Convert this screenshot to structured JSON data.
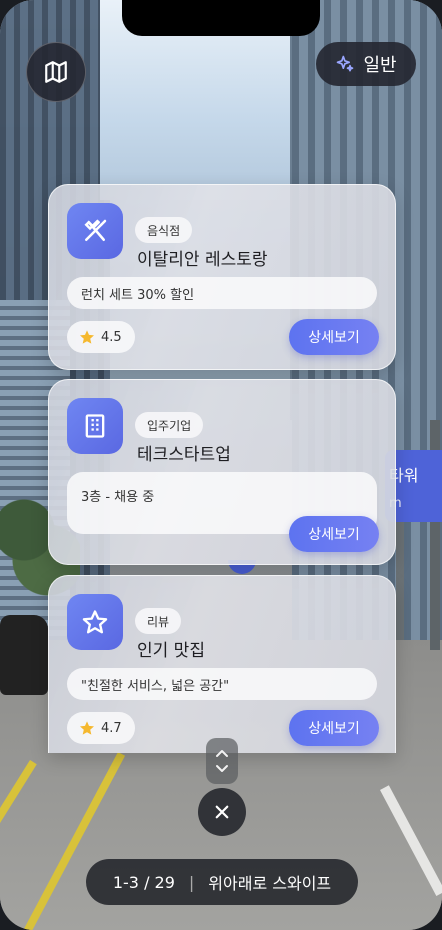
{
  "top": {
    "map_icon": "map-icon",
    "mode_label": "일반",
    "mode_icon": "sparkle-icon"
  },
  "landmark": {
    "title": "타워",
    "distance": "m"
  },
  "cards": [
    {
      "icon": "restaurant-icon",
      "category": "음식점",
      "name": "이탈리안 레스토랑",
      "description": "런치 세트 30% 할인",
      "rating": "4.5",
      "detail_label": "상세보기"
    },
    {
      "icon": "building-icon",
      "category": "입주기업",
      "name": "테크스타트업",
      "description": "3층 - 채용 중",
      "detail_label": "상세보기"
    },
    {
      "icon": "star-icon",
      "category": "리뷰",
      "name": "인기 맛집",
      "description": "\"친절한 서비스, 넓은 공간\"",
      "rating": "4.7",
      "detail_label": "상세보기"
    }
  ],
  "bottom": {
    "page_indicator": "1-3 / 29",
    "swipe_hint": "위아래로 스와이프",
    "close_icon": "close-icon",
    "scroll_icon": "chevron-up-down-icon"
  },
  "colors": {
    "accent": "#5d73f0",
    "dark_pill": "#282a30",
    "star": "#f5b82e"
  }
}
